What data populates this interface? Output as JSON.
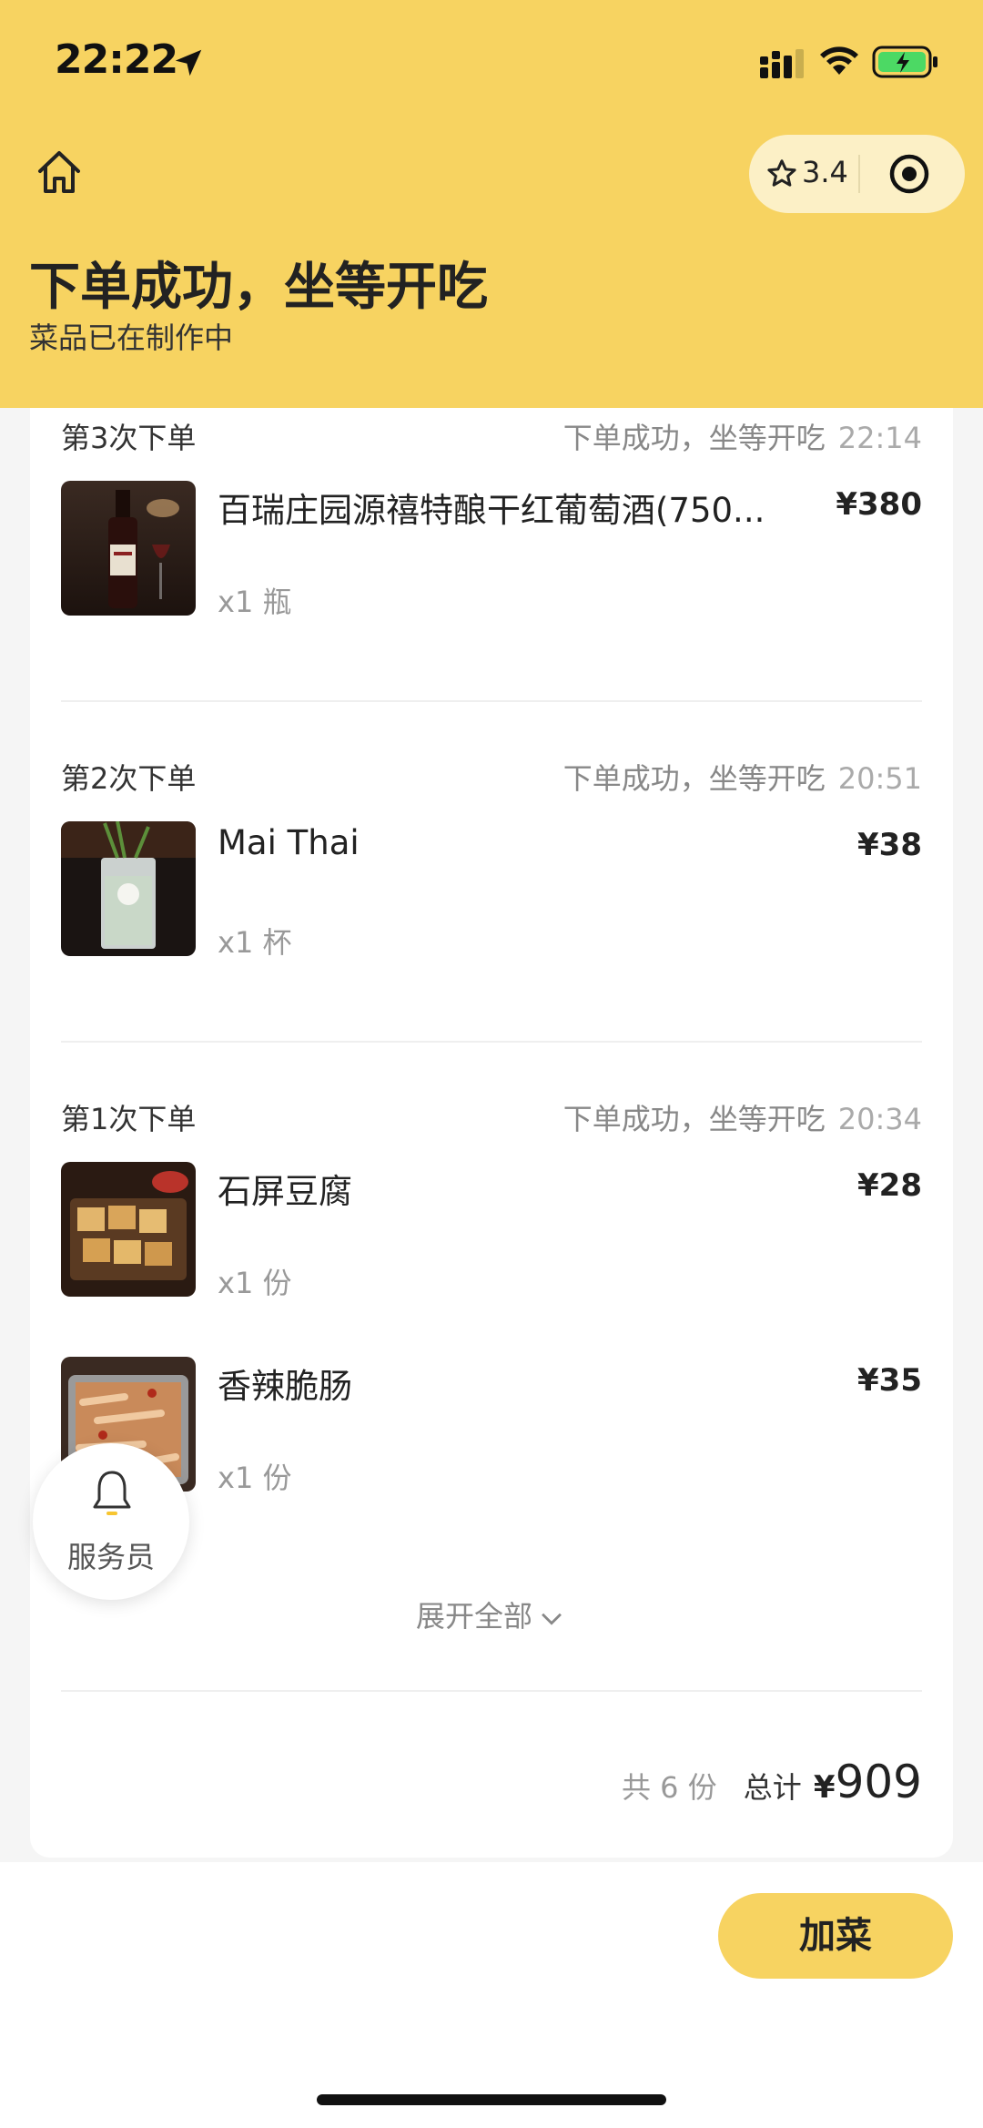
{
  "status_bar": {
    "time": "22:22"
  },
  "header": {
    "rating": "3.4",
    "title": "下单成功，坐等开吃",
    "subtitle": "菜品已在制作中"
  },
  "orders": [
    {
      "label": "第3次下单",
      "status": "下单成功，坐等开吃",
      "time": "22:14",
      "items": [
        {
          "name": "百瑞庄园源禧特酿干红葡萄酒(750...",
          "price": "¥380",
          "qty": "x1 瓶",
          "thumb": "wine-bottle-image"
        }
      ]
    },
    {
      "label": "第2次下单",
      "status": "下单成功，坐等开吃",
      "time": "20:51",
      "items": [
        {
          "name": "Mai Thai",
          "price": "¥38",
          "qty": "x1 杯",
          "thumb": "cocktail-image"
        }
      ]
    },
    {
      "label": "第1次下单",
      "status": "下单成功，坐等开吃",
      "time": "20:34",
      "items": [
        {
          "name": "石屏豆腐",
          "price": "¥28",
          "qty": "x1 份",
          "thumb": "tofu-image"
        },
        {
          "name": "香辣脆肠",
          "price": "¥35",
          "qty": "x1 份",
          "thumb": "sausage-image"
        }
      ]
    }
  ],
  "expand_label": "展开全部",
  "summary": {
    "count_label": "共 6 份",
    "total_label": "总计",
    "currency": "¥",
    "total_amount": "909"
  },
  "waiter_label": "服务员",
  "add_button_label": "加菜",
  "colors": {
    "brand_yellow": "#F7D361",
    "capsule": "#FCF0C6"
  }
}
